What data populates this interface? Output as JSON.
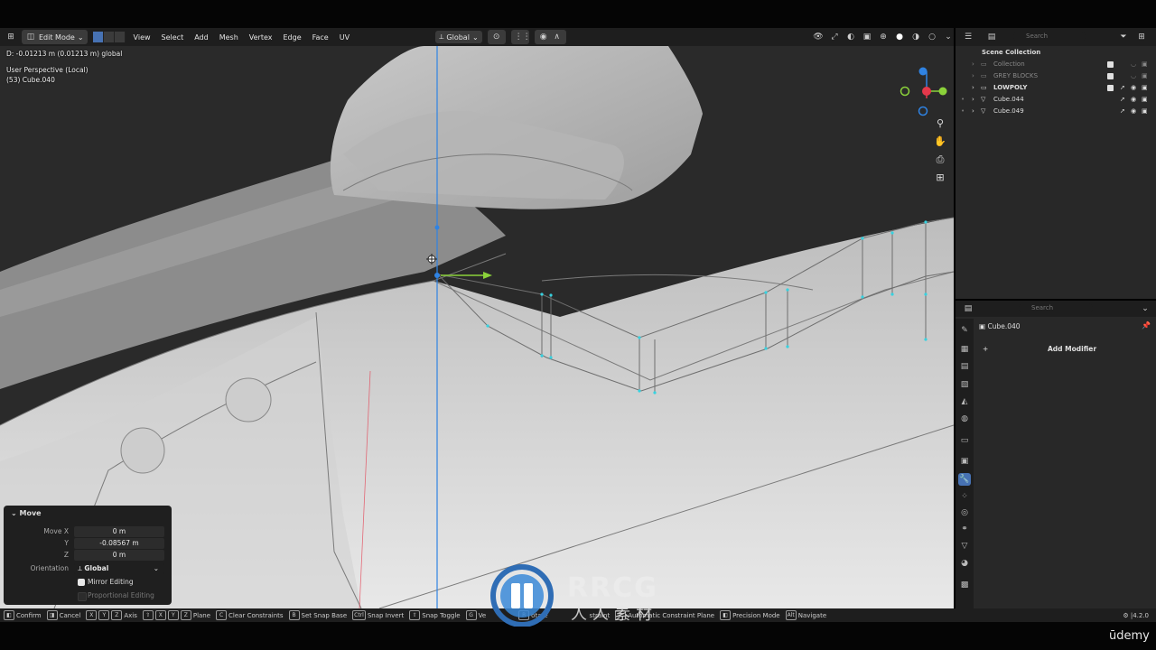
{
  "header": {
    "mode": "Edit Mode",
    "menu": [
      "View",
      "Select",
      "Add",
      "Mesh",
      "Vertex",
      "Edge",
      "Face",
      "UV"
    ],
    "transform_orientation": "Global"
  },
  "viewport": {
    "delta_readout": "D: -0.01213 m (0.01213 m) global",
    "view_name": "User Perspective (Local)",
    "object_name": "(53) Cube.040"
  },
  "move_panel": {
    "title": "Move",
    "rows": [
      {
        "label": "Move X",
        "value": "0 m"
      },
      {
        "label": "Y",
        "value": "-0.08567 m"
      },
      {
        "label": "Z",
        "value": "0 m"
      }
    ],
    "orientation_label": "Orientation",
    "orientation_value": "Global",
    "mirror_editing": "Mirror Editing",
    "proportional_editing": "Proportional Editing"
  },
  "outliner": {
    "search_placeholder": "Search",
    "scene_collection": "Scene Collection",
    "items": [
      {
        "name": "Collection"
      },
      {
        "name": "GREY BLOCKS"
      },
      {
        "name": "LOWPOLY"
      },
      {
        "name": "Cube.044"
      },
      {
        "name": "Cube.049"
      }
    ]
  },
  "properties": {
    "search_placeholder": "Search",
    "object_name": "Cube.040",
    "add_modifier": "Add Modifier"
  },
  "statusbar": {
    "items": [
      {
        "keys": [],
        "label": "Confirm"
      },
      {
        "keys": [],
        "label": "Cancel"
      },
      {
        "keys": [
          "X",
          "Y",
          "Z"
        ],
        "label": "Axis"
      },
      {
        "keys": [
          "⇧",
          "X",
          "Y",
          "Z"
        ],
        "label": "Plane"
      },
      {
        "keys": [
          "C"
        ],
        "label": "Clear Constraints"
      },
      {
        "keys": [
          "B"
        ],
        "label": "Set Snap Base"
      },
      {
        "keys": [
          "Ctrl"
        ],
        "label": "Snap Invert"
      },
      {
        "keys": [
          "⇧"
        ],
        "label": "Snap Toggle"
      },
      {
        "keys": [
          "G"
        ],
        "label": "Ve"
      },
      {
        "keys": [
          "R"
        ],
        "label": "otate"
      },
      {
        "keys": [],
        "label": "straint"
      },
      {
        "keys": [
          "⇧"
        ],
        "label": "Automatic Constraint Plane"
      },
      {
        "keys": [],
        "label": "Precision Mode"
      },
      {
        "keys": [
          "Alt"
        ],
        "label": "Navigate"
      }
    ],
    "version": "4.2.0"
  },
  "watermark": {
    "brand": "RRCG",
    "cn_text": "人人素材",
    "udemy": "ūdemy"
  },
  "colors": {
    "selection": "#4772b3",
    "axis_x": "#e5384b",
    "axis_y": "#8bd23a",
    "axis_z": "#2f83e3",
    "vertex": "#36d2e0"
  }
}
